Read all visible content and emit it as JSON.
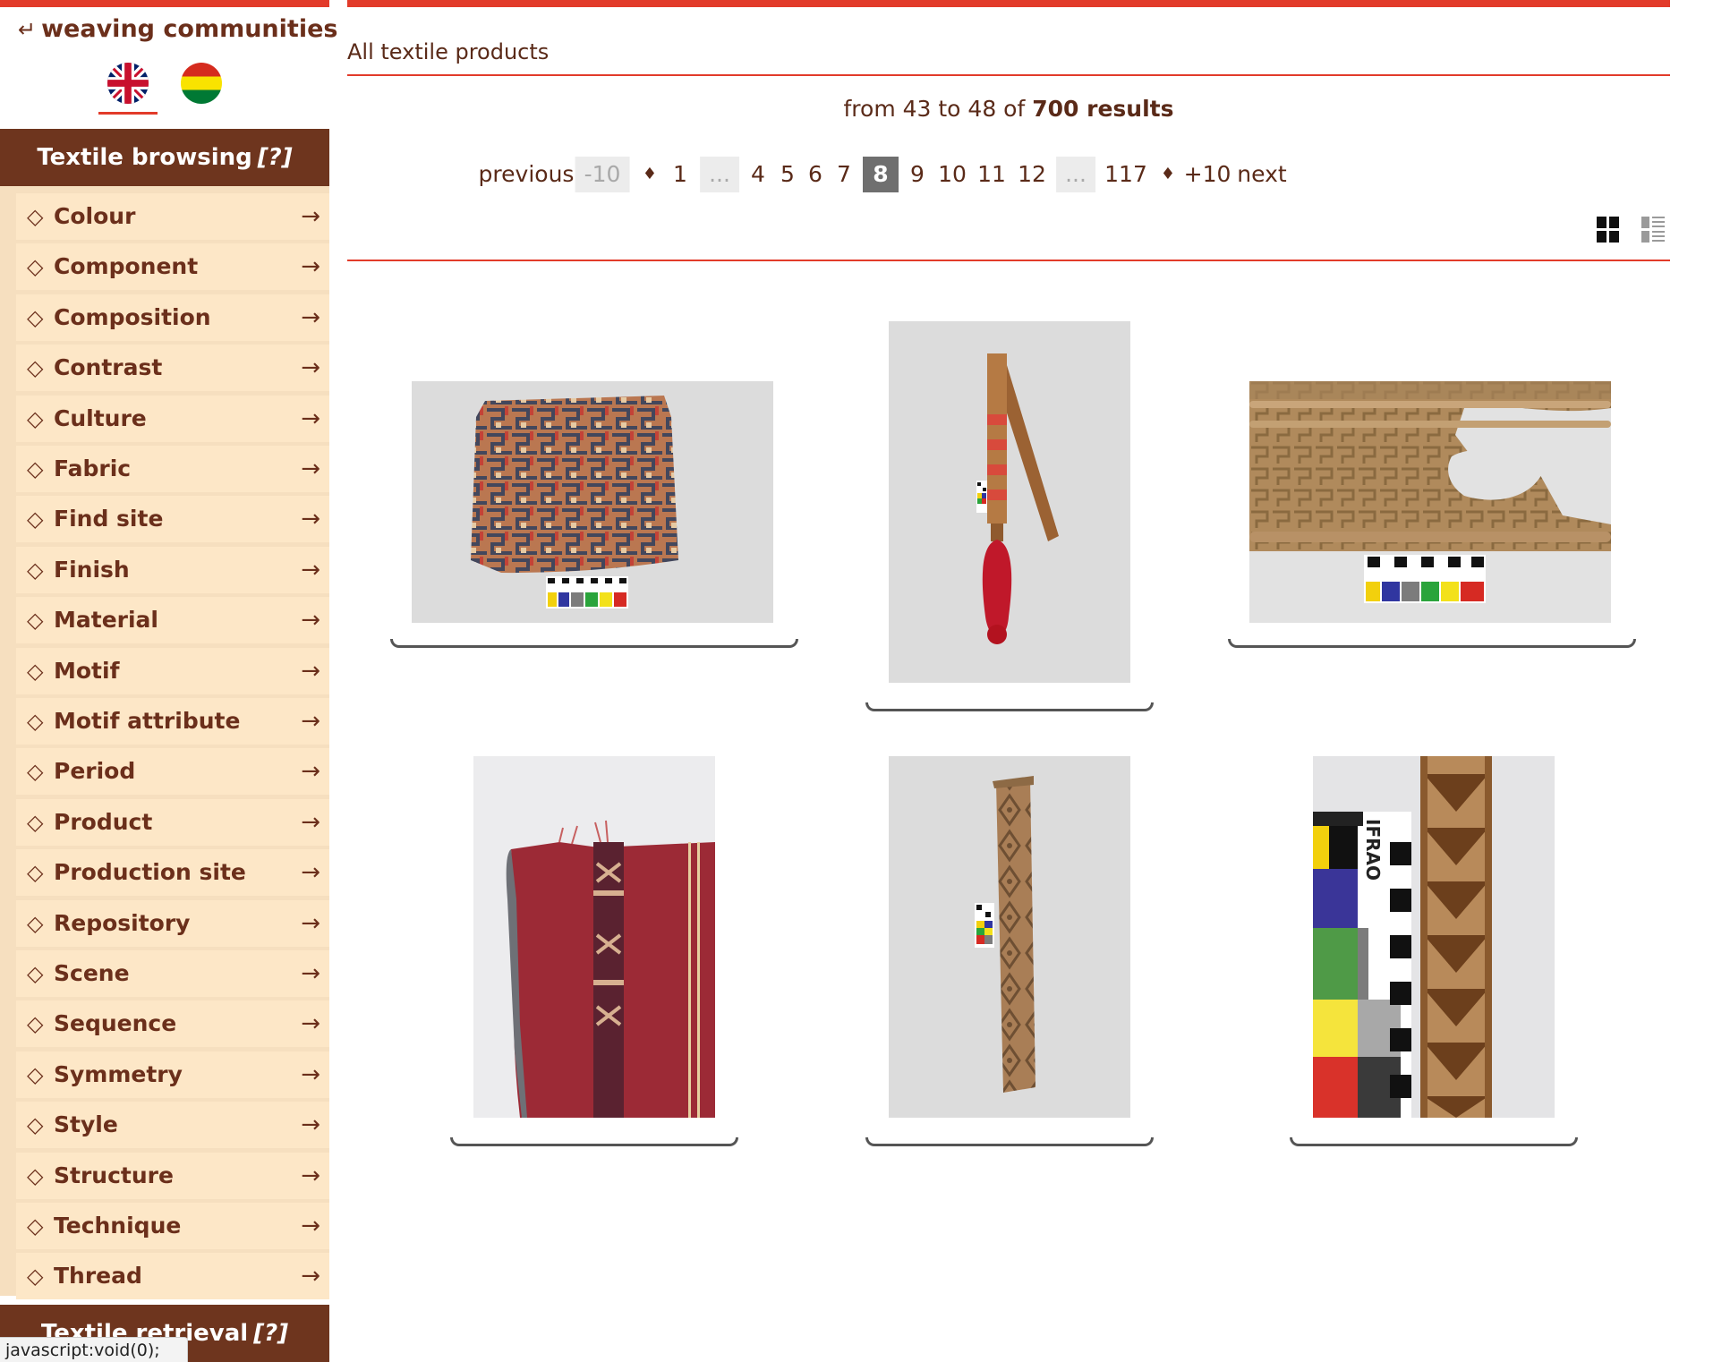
{
  "sidebar": {
    "back_label": "weaving communities",
    "languages": [
      "English",
      "Español"
    ],
    "browse_header": "Textile browsing",
    "help_marker": "[?]",
    "items": [
      {
        "label": "Colour"
      },
      {
        "label": "Component"
      },
      {
        "label": "Composition"
      },
      {
        "label": "Contrast"
      },
      {
        "label": "Culture"
      },
      {
        "label": "Fabric"
      },
      {
        "label": "Find site"
      },
      {
        "label": "Finish"
      },
      {
        "label": "Material"
      },
      {
        "label": "Motif"
      },
      {
        "label": "Motif attribute"
      },
      {
        "label": "Period"
      },
      {
        "label": "Product"
      },
      {
        "label": "Production site"
      },
      {
        "label": "Repository"
      },
      {
        "label": "Scene"
      },
      {
        "label": "Sequence"
      },
      {
        "label": "Symmetry"
      },
      {
        "label": "Style"
      },
      {
        "label": "Structure"
      },
      {
        "label": "Technique"
      },
      {
        "label": "Thread"
      }
    ],
    "item_marker": "◇",
    "item_arrow": "→",
    "retrieval_header": "Textile retrieval"
  },
  "main": {
    "title": "All textile products",
    "summary_prefix": "from 43 to 48 of ",
    "summary_total": "700 results",
    "pagination": {
      "previous": "previous",
      "minus_ten": "-10",
      "separator": "♦",
      "first": "1",
      "ellipsis": "...",
      "pages_before": [
        "4",
        "5",
        "6",
        "7"
      ],
      "current": "8",
      "pages_after": [
        "9",
        "10",
        "11",
        "12"
      ],
      "last": "117",
      "plus_ten": "+10",
      "next": "next"
    },
    "view_modes": [
      "grid-view-icon",
      "list-view-icon"
    ]
  },
  "status_bar": "javascript:void(0);",
  "colors": {
    "accent_red": "#e23b2a",
    "header_brown": "#6e351e",
    "menu_beige": "#fde7c7",
    "text_brown": "#6b2f1b"
  }
}
